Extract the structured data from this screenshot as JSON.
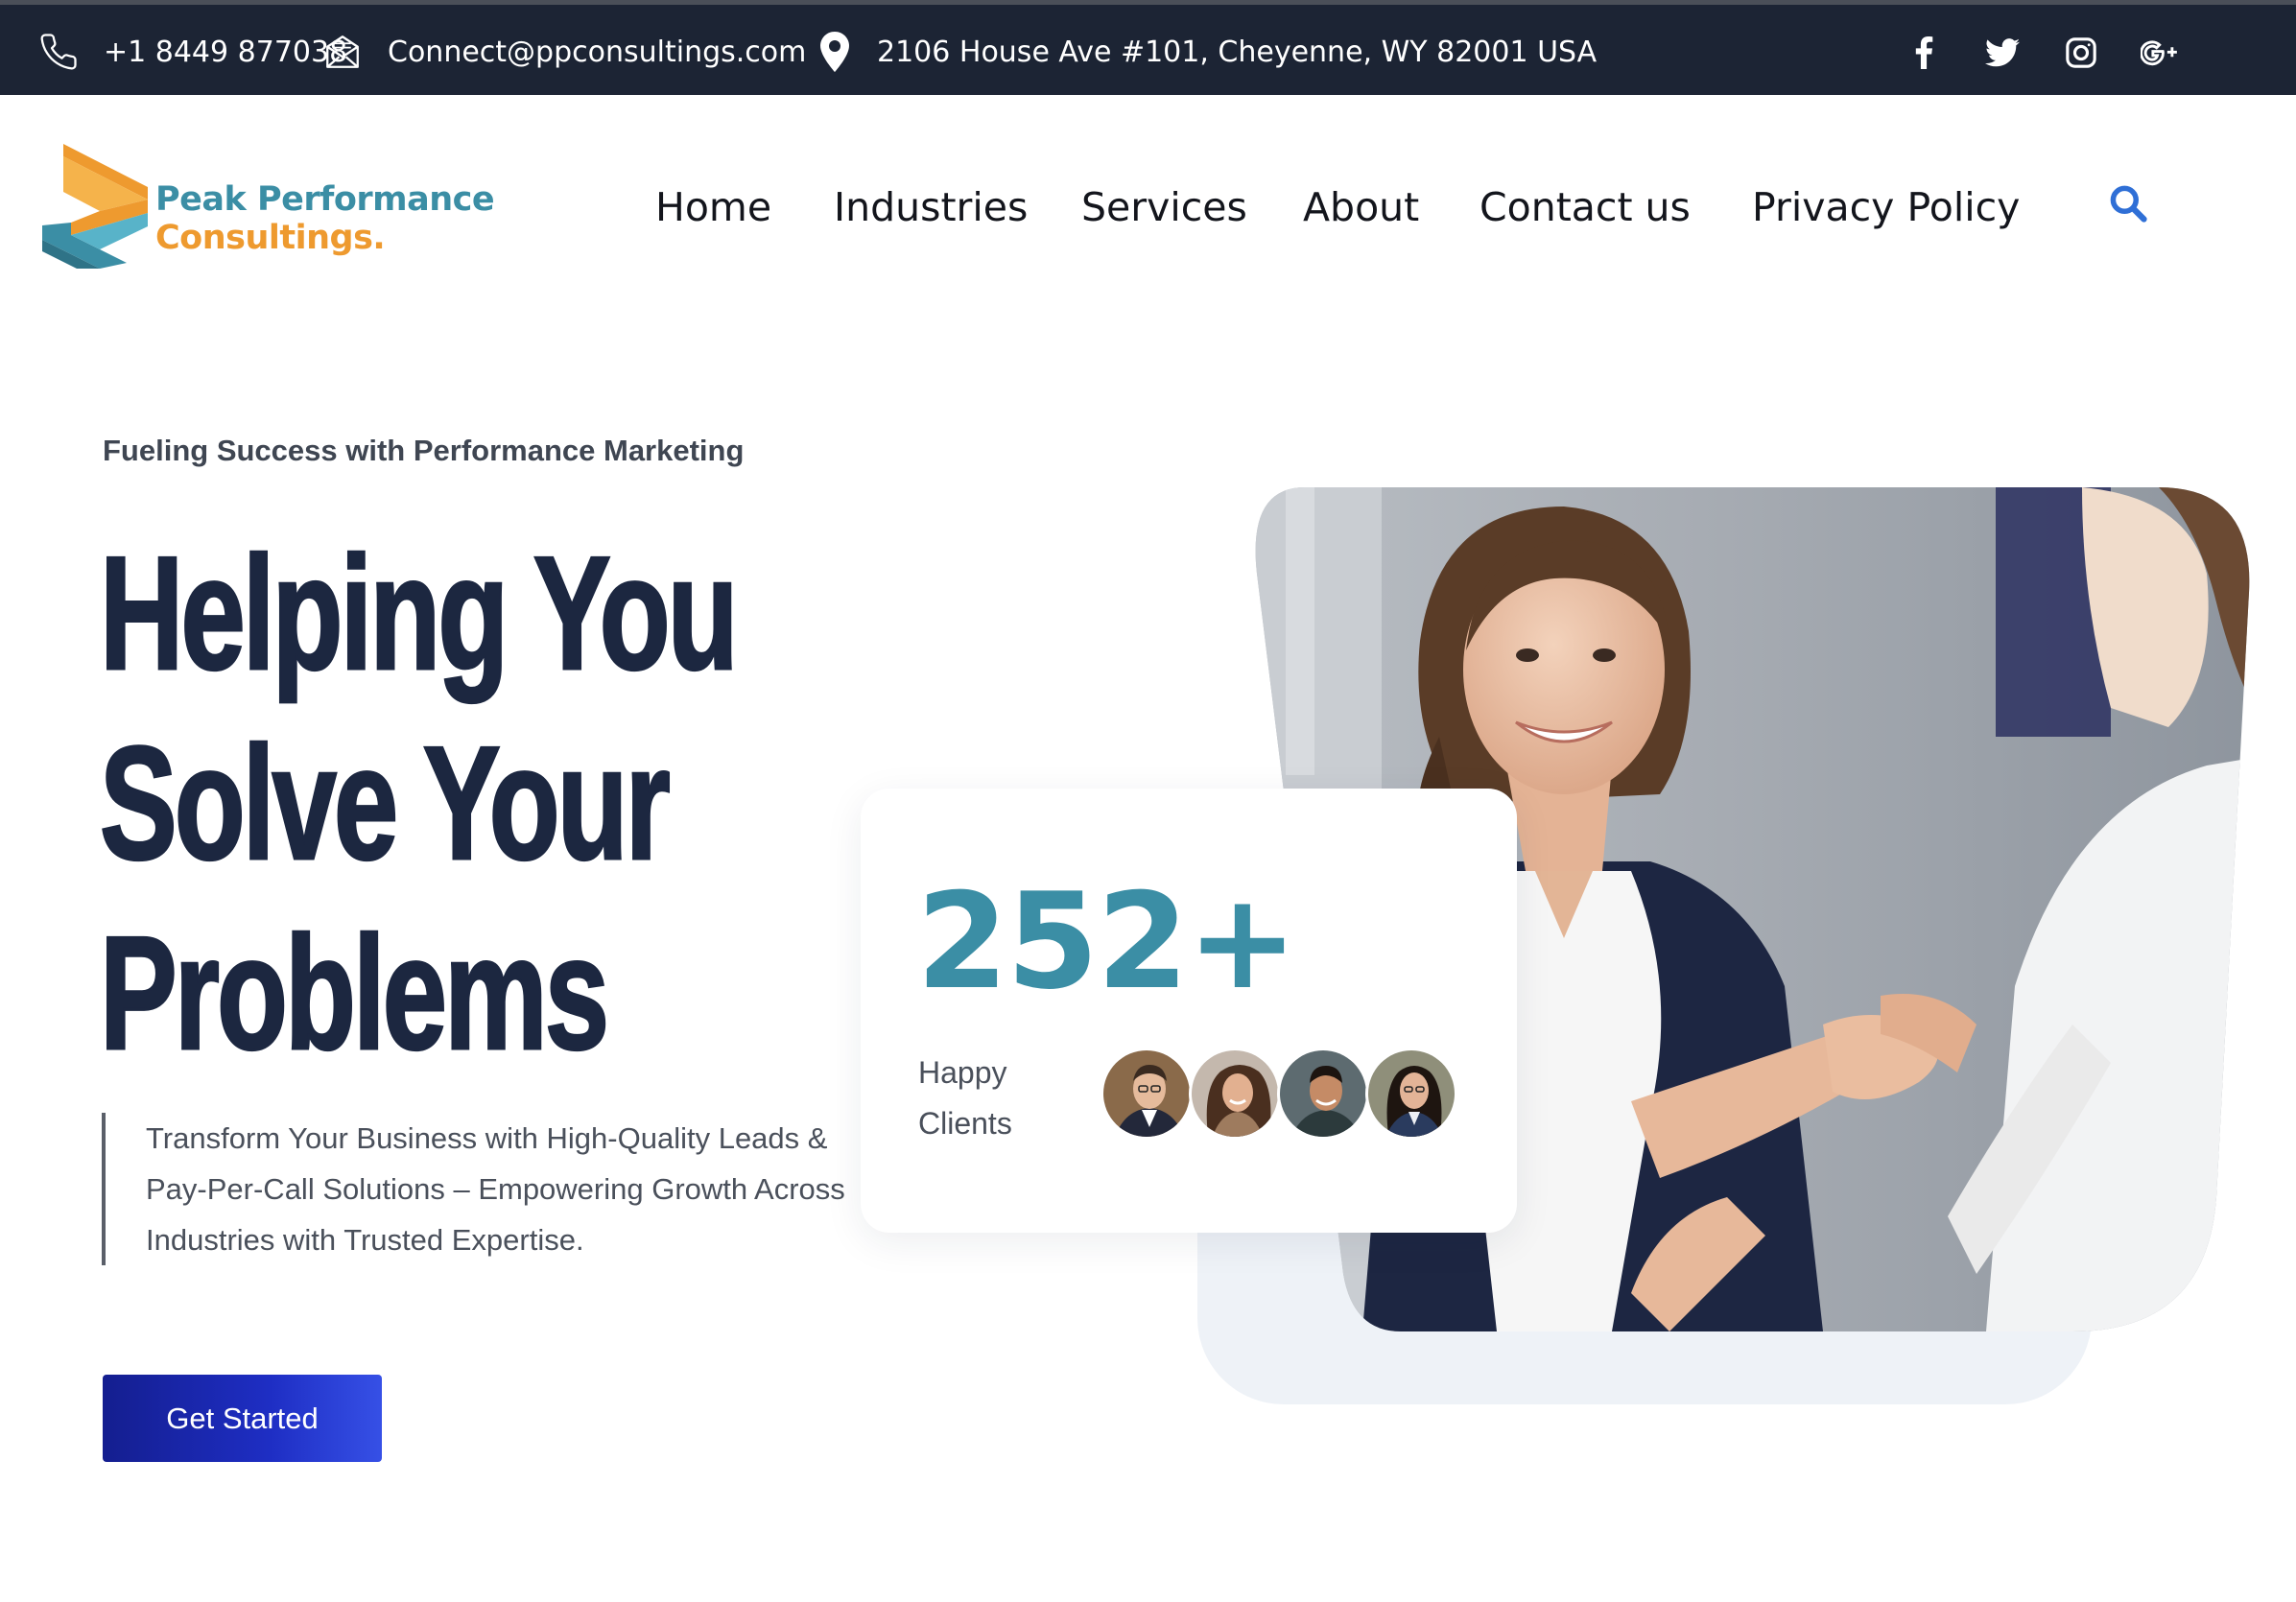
{
  "topbar": {
    "phone": "+1 8449 877038",
    "email": "Connect@ppconsultings.com",
    "address": "2106 House Ave #101, Cheyenne, WY 82001 USA",
    "social": [
      "facebook-icon",
      "twitter-icon",
      "instagram-icon",
      "google-plus-icon"
    ]
  },
  "logo": {
    "line1": "Peak Performance",
    "line2": "Consultings."
  },
  "nav": {
    "items": [
      "Home",
      "Industries",
      "Services",
      "About",
      "Contact us",
      "Privacy Policy"
    ]
  },
  "hero": {
    "eyebrow": "Fueling Success with Performance Marketing",
    "headline": [
      "Helping You",
      "Solve Your",
      "Problems"
    ],
    "description": "Transform Your Business with High-Quality Leads & Pay-Per-Call Solutions – Empowering Growth Across Industries with Trusted Expertise.",
    "cta": "Get Started"
  },
  "stats": {
    "value": "252+",
    "label": "Happy Clients"
  },
  "colors": {
    "topbar_bg": "#1c2434",
    "brand_teal": "#3b8ea5",
    "brand_orange": "#ee9a2f",
    "headline": "#1c2740",
    "cta_start": "#141e8f",
    "cta_end": "#3650e6",
    "search_icon": "#2f6fd6"
  }
}
